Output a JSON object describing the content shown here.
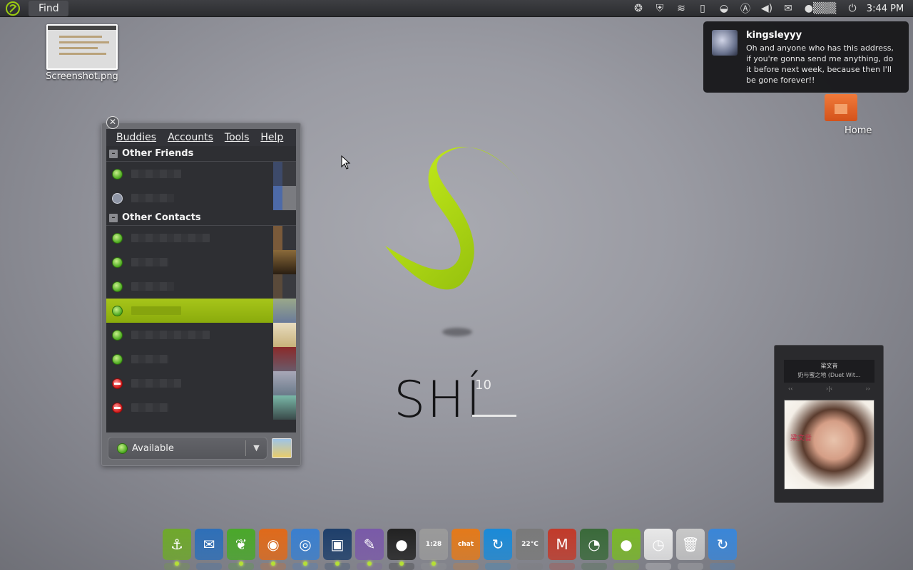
{
  "top_panel": {
    "find_label": "Find",
    "clock": "3:44 PM",
    "tray_icons": [
      "app-indicator-icon",
      "shield-icon",
      "wifi-icon",
      "battery-icon",
      "sync-icon",
      "keyboard-layout-icon",
      "volume-icon",
      "mail-icon",
      "toggle-icon",
      "power-icon"
    ]
  },
  "desktop": {
    "icons": [
      {
        "label": "Screenshot.png",
        "icon": "image-file-icon"
      },
      {
        "label": "Home",
        "icon": "home-folder-icon"
      }
    ]
  },
  "notification": {
    "sender": "kingsleyyy",
    "body": "Oh and anyone who has this address, if you're gonna send me anything, do it before next week, because then I'll be gone forever!!"
  },
  "buddy_list": {
    "menu": [
      "Buddies",
      "Accounts",
      "Tools",
      "Help"
    ],
    "groups": [
      {
        "name": "Other Friends",
        "buddies": [
          {
            "status": "available"
          },
          {
            "status": "away"
          }
        ]
      },
      {
        "name": "Other Contacts",
        "buddies": [
          {
            "status": "available"
          },
          {
            "status": "available"
          },
          {
            "status": "available"
          },
          {
            "status": "available",
            "selected": true
          },
          {
            "status": "available"
          },
          {
            "status": "available"
          },
          {
            "status": "busy"
          },
          {
            "status": "busy"
          }
        ]
      }
    ],
    "status_selector": {
      "value": "Available"
    }
  },
  "wallpaper": {
    "brand": "SHÍ",
    "version": "10",
    "accent_color": "#9ccc12"
  },
  "music_widget": {
    "artist": "梁文音",
    "track": "奶与蜜之地 (Duet Wit...",
    "controls": [
      "‹‹",
      "›|‹",
      "››"
    ],
    "cover_text": "梁文音"
  },
  "dock": {
    "items": [
      {
        "name": "anchor-app",
        "icon": "anchor-icon",
        "label": "⚓",
        "color": "#6fa82c"
      },
      {
        "name": "thunderbird",
        "icon": "thunderbird-icon",
        "label": "✉",
        "color": "#2e6fb8"
      },
      {
        "name": "leaf-app",
        "icon": "leaf-icon",
        "label": "❦",
        "color": "#4aa82a"
      },
      {
        "name": "firefox",
        "icon": "firefox-icon",
        "label": "◉",
        "color": "#e06a1a"
      },
      {
        "name": "chromium",
        "icon": "chromium-icon",
        "label": "◎",
        "color": "#3a7fcf"
      },
      {
        "name": "image-viewer",
        "icon": "photo-icon",
        "label": "▣",
        "color": "#1e3f6b"
      },
      {
        "name": "pidgin",
        "icon": "pidgin-icon",
        "label": "✎",
        "color": "#7a5aa8"
      },
      {
        "name": "qq",
        "icon": "penguin-icon",
        "label": "●",
        "color": "#222222"
      },
      {
        "name": "clock-app",
        "icon": "clock-badge-icon",
        "label": "1:28",
        "color": "#9a9a9a"
      },
      {
        "name": "xchat",
        "icon": "xchat-icon",
        "label": "chat",
        "color": "#e47a1a"
      },
      {
        "name": "refresh-app",
        "icon": "circle-arrow-icon",
        "label": "↻",
        "color": "#1a8ad8"
      },
      {
        "name": "weather",
        "icon": "weather-icon",
        "label": "22°C",
        "color": "#7a7a7a"
      },
      {
        "name": "gmail",
        "icon": "gmail-icon",
        "label": "M",
        "color": "#c23a2a"
      },
      {
        "name": "system-monitor",
        "icon": "monitor-icon",
        "label": "◔",
        "color": "#3a6a3a"
      },
      {
        "name": "green-orb",
        "icon": "orb-icon",
        "label": "●",
        "color": "#7ab828"
      },
      {
        "name": "clock",
        "icon": "clock-icon",
        "label": "◷",
        "color": "#e8e8e8"
      },
      {
        "name": "trash",
        "icon": "trash-icon",
        "label": "🗑",
        "color": "#c8c8c8"
      },
      {
        "name": "update",
        "icon": "update-icon",
        "label": "↻",
        "color": "#3a86d8"
      }
    ]
  }
}
